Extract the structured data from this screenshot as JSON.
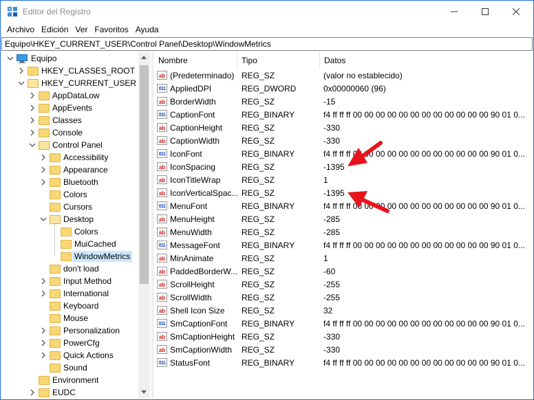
{
  "window": {
    "title": "Editor del Registro",
    "controls": {
      "minimize": "—",
      "maximize": "☐",
      "close": "✕"
    }
  },
  "menu": [
    "Archivo",
    "Edición",
    "Ver",
    "Favoritos",
    "Ayuda"
  ],
  "address": "Equipo\\HKEY_CURRENT_USER\\Control Panel\\Desktop\\WindowMetrics",
  "tree": [
    {
      "label": "Equipo",
      "level": 0,
      "kind": "pc",
      "state": "open"
    },
    {
      "label": "HKEY_CLASSES_ROOT",
      "level": 1,
      "kind": "folder",
      "state": "closed"
    },
    {
      "label": "HKEY_CURRENT_USER",
      "level": 1,
      "kind": "folder",
      "state": "open"
    },
    {
      "label": "AppDataLow",
      "level": 2,
      "kind": "folder",
      "state": "closed"
    },
    {
      "label": "AppEvents",
      "level": 2,
      "kind": "folder",
      "state": "closed"
    },
    {
      "label": "Classes",
      "level": 2,
      "kind": "folder",
      "state": "closed"
    },
    {
      "label": "Console",
      "level": 2,
      "kind": "folder",
      "state": "closed"
    },
    {
      "label": "Control Panel",
      "level": 2,
      "kind": "folder",
      "state": "open"
    },
    {
      "label": "Accessibility",
      "level": 3,
      "kind": "folder",
      "state": "closed"
    },
    {
      "label": "Appearance",
      "level": 3,
      "kind": "folder",
      "state": "closed"
    },
    {
      "label": "Bluetooth",
      "level": 3,
      "kind": "folder",
      "state": "closed"
    },
    {
      "label": "Colors",
      "level": 3,
      "kind": "folder",
      "state": "none"
    },
    {
      "label": "Cursors",
      "level": 3,
      "kind": "folder",
      "state": "none"
    },
    {
      "label": "Desktop",
      "level": 3,
      "kind": "folder",
      "state": "open"
    },
    {
      "label": "Colors",
      "level": 4,
      "kind": "folder",
      "state": "none"
    },
    {
      "label": "MuiCached",
      "level": 4,
      "kind": "folder",
      "state": "none"
    },
    {
      "label": "WindowMetrics",
      "level": 4,
      "kind": "folder",
      "state": "none",
      "selected": true
    },
    {
      "label": "don't load",
      "level": 3,
      "kind": "folder",
      "state": "none"
    },
    {
      "label": "Input Method",
      "level": 3,
      "kind": "folder",
      "state": "closed"
    },
    {
      "label": "International",
      "level": 3,
      "kind": "folder",
      "state": "closed"
    },
    {
      "label": "Keyboard",
      "level": 3,
      "kind": "folder",
      "state": "none"
    },
    {
      "label": "Mouse",
      "level": 3,
      "kind": "folder",
      "state": "none"
    },
    {
      "label": "Personalization",
      "level": 3,
      "kind": "folder",
      "state": "closed"
    },
    {
      "label": "PowerCfg",
      "level": 3,
      "kind": "folder",
      "state": "closed"
    },
    {
      "label": "Quick Actions",
      "level": 3,
      "kind": "folder",
      "state": "closed"
    },
    {
      "label": "Sound",
      "level": 3,
      "kind": "folder",
      "state": "none"
    },
    {
      "label": "Environment",
      "level": 2,
      "kind": "folder",
      "state": "none"
    },
    {
      "label": "EUDC",
      "level": 2,
      "kind": "folder",
      "state": "closed"
    }
  ],
  "columns": {
    "name": "Nombre",
    "type": "Tipo",
    "data": "Datos"
  },
  "values": [
    {
      "name": "(Predeterminado)",
      "type": "REG_SZ",
      "data": "(valor no establecido)",
      "icon": "sz"
    },
    {
      "name": "AppliedDPI",
      "type": "REG_DWORD",
      "data": "0x00000060 (96)",
      "icon": "bin"
    },
    {
      "name": "BorderWidth",
      "type": "REG_SZ",
      "data": "-15",
      "icon": "sz"
    },
    {
      "name": "CaptionFont",
      "type": "REG_BINARY",
      "data": "f4 ff ff ff 00 00 00 00 00 00 00 00 00 00 00 00 90 01 0...",
      "icon": "bin"
    },
    {
      "name": "CaptionHeight",
      "type": "REG_SZ",
      "data": "-330",
      "icon": "sz"
    },
    {
      "name": "CaptionWidth",
      "type": "REG_SZ",
      "data": "-330",
      "icon": "sz"
    },
    {
      "name": "IconFont",
      "type": "REG_BINARY",
      "data": "f4 ff ff ff 00 00 00 00 00 00 00 00 00 00 00 00 90 01 0...",
      "icon": "bin"
    },
    {
      "name": "IconSpacing",
      "type": "REG_SZ",
      "data": "-1395",
      "icon": "sz"
    },
    {
      "name": "IconTitleWrap",
      "type": "REG_SZ",
      "data": "1",
      "icon": "sz"
    },
    {
      "name": "IconVerticalSpac...",
      "type": "REG_SZ",
      "data": "-1395",
      "icon": "sz"
    },
    {
      "name": "MenuFont",
      "type": "REG_BINARY",
      "data": "f4 ff ff ff 00 00 00 00 00 00 00 00 00 00 00 00 90 01 0...",
      "icon": "bin"
    },
    {
      "name": "MenuHeight",
      "type": "REG_SZ",
      "data": "-285",
      "icon": "sz"
    },
    {
      "name": "MenuWidth",
      "type": "REG_SZ",
      "data": "-285",
      "icon": "sz"
    },
    {
      "name": "MessageFont",
      "type": "REG_BINARY",
      "data": "f4 ff ff ff 00 00 00 00 00 00 00 00 00 00 00 00 90 01 0...",
      "icon": "bin"
    },
    {
      "name": "MinAnimate",
      "type": "REG_SZ",
      "data": "1",
      "icon": "sz"
    },
    {
      "name": "PaddedBorderW...",
      "type": "REG_SZ",
      "data": "-60",
      "icon": "sz"
    },
    {
      "name": "ScrollHeight",
      "type": "REG_SZ",
      "data": "-255",
      "icon": "sz"
    },
    {
      "name": "ScrollWidth",
      "type": "REG_SZ",
      "data": "-255",
      "icon": "sz"
    },
    {
      "name": "Shell Icon Size",
      "type": "REG_SZ",
      "data": "32",
      "icon": "sz"
    },
    {
      "name": "SmCaptionFont",
      "type": "REG_BINARY",
      "data": "f4 ff ff ff 00 00 00 00 00 00 00 00 00 00 00 00 90 01 0...",
      "icon": "bin"
    },
    {
      "name": "SmCaptionHeight",
      "type": "REG_SZ",
      "data": "-330",
      "icon": "sz"
    },
    {
      "name": "SmCaptionWidth",
      "type": "REG_SZ",
      "data": "-330",
      "icon": "sz"
    },
    {
      "name": "StatusFont",
      "type": "REG_BINARY",
      "data": "f4 ff ff ff 00 00 00 00 00 00 00 00 00 00 00 00 90 01 0...",
      "icon": "bin"
    }
  ],
  "annotation_color": "#e8141c",
  "icons": {
    "sz": "ab",
    "bin": "011"
  }
}
